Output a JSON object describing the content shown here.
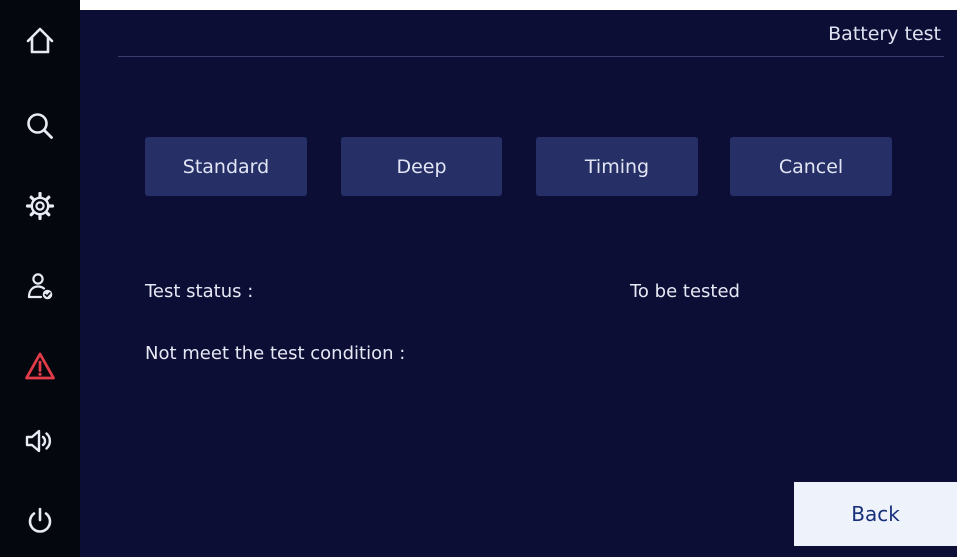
{
  "header": {
    "title": "Battery test"
  },
  "sidebar": {
    "items": [
      {
        "icon": "home-icon"
      },
      {
        "icon": "search-icon"
      },
      {
        "icon": "gear-icon"
      },
      {
        "icon": "user-check-icon"
      },
      {
        "icon": "warning-icon"
      },
      {
        "icon": "speaker-icon"
      },
      {
        "icon": "power-icon"
      }
    ]
  },
  "test_buttons": {
    "standard": "Standard",
    "deep": "Deep",
    "timing": "Timing",
    "cancel": "Cancel"
  },
  "status": {
    "test_status_label": "Test status :",
    "test_status_value": "To be tested",
    "condition_label": "Not meet the test condition :"
  },
  "footer": {
    "back_label": "Back"
  },
  "colors": {
    "sidebar_bg": "#05070f",
    "panel_bg": "#0c0e36",
    "button_bg": "#263067",
    "warning": "#e23b4a",
    "back_button_bg": "#eef2fb",
    "back_button_text": "#17307a"
  }
}
